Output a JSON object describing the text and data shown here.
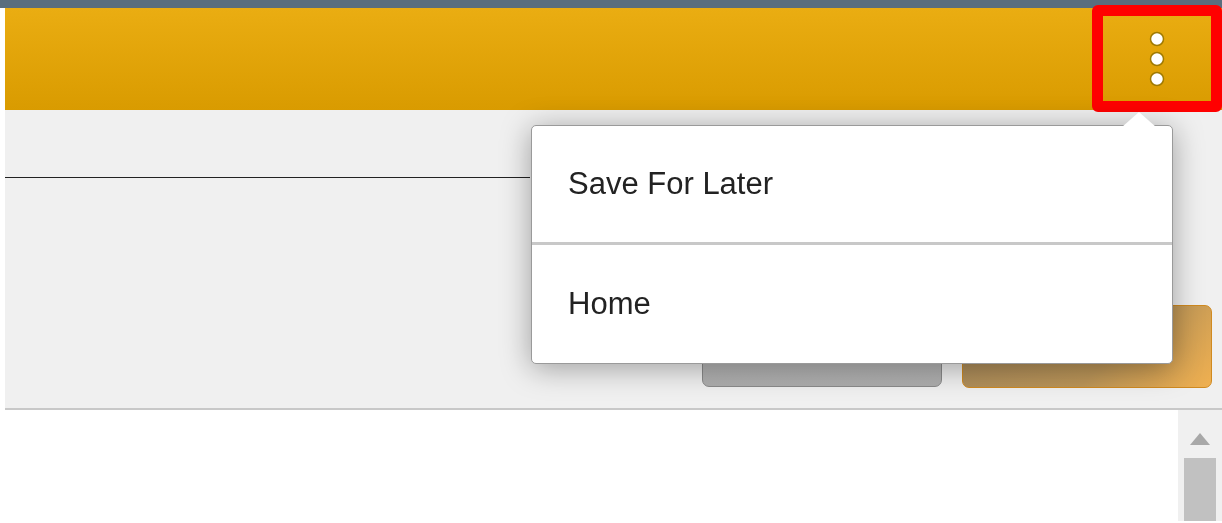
{
  "header": {
    "menu_button": {
      "highlighted": true
    }
  },
  "menu": {
    "items": [
      {
        "label": "Save For Later"
      },
      {
        "label": "Home"
      }
    ]
  },
  "toolbar": {
    "buttons": [
      {
        "kind": "secondary"
      },
      {
        "kind": "primary"
      }
    ]
  }
}
